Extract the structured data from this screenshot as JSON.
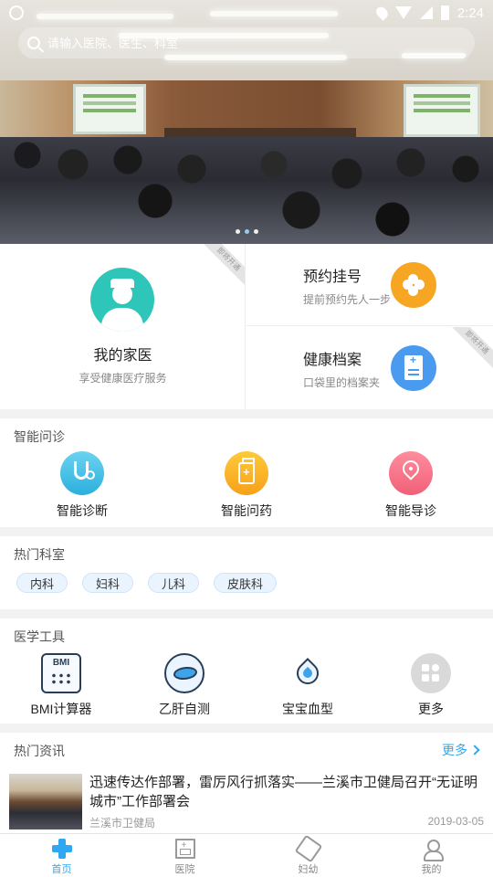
{
  "status_bar": {
    "time": "2:24"
  },
  "search": {
    "placeholder": "请输入医院、医生、科室"
  },
  "banner": {
    "page_count": 3,
    "active_index": 1
  },
  "features": {
    "family_doctor": {
      "title": "我的家医",
      "subtitle": "享受健康医疗服务",
      "badge": "即将开通"
    },
    "appointment": {
      "title": "预约挂号",
      "subtitle": "提前预约先人一步"
    },
    "health_records": {
      "title": "健康档案",
      "subtitle": "口袋里的档案夹",
      "badge": "即将开通"
    }
  },
  "smart_consult": {
    "title": "智能问诊",
    "items": [
      {
        "label": "智能诊断",
        "icon": "stethoscope-icon"
      },
      {
        "label": "智能问药",
        "icon": "medicine-bottle-icon"
      },
      {
        "label": "智能导诊",
        "icon": "location-pin-icon"
      }
    ]
  },
  "hot_departments": {
    "title": "热门科室",
    "items": [
      "内科",
      "妇科",
      "儿科",
      "皮肤科"
    ]
  },
  "medical_tools": {
    "title": "医学工具",
    "items": [
      {
        "label": "BMI计算器",
        "icon": "bmi-calculator-icon",
        "icon_text": "BMI"
      },
      {
        "label": "乙肝自测",
        "icon": "liver-icon"
      },
      {
        "label": "宝宝血型",
        "icon": "blood-drop-icon"
      },
      {
        "label": "更多",
        "icon": "more-grid-icon"
      }
    ]
  },
  "hot_news": {
    "title": "热门资讯",
    "more_label": "更多",
    "article": {
      "title": "迅速传达作部署，雷厉风行抓落实——兰溪市卫健局召开“无证明城市”工作部署会",
      "source": "兰溪市卫健局",
      "date": "2019-03-05"
    }
  },
  "tab_bar": {
    "items": [
      {
        "label": "首页",
        "active": true
      },
      {
        "label": "医院",
        "active": false
      },
      {
        "label": "妇幼",
        "active": false
      },
      {
        "label": "我的",
        "active": false
      }
    ]
  },
  "colors": {
    "accent": "#2ea8f0",
    "teal": "#2ec6b8",
    "orange": "#f6a623",
    "blue": "#4a9af0",
    "pink": "#f16078"
  }
}
